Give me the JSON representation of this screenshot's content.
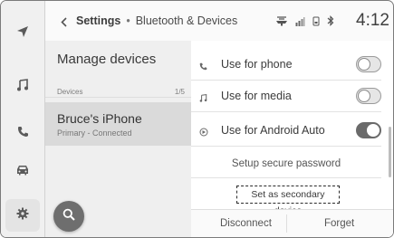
{
  "header": {
    "back_icon": "chevron-left-icon",
    "breadcrumb_primary": "Settings",
    "breadcrumb_separator": "•",
    "breadcrumb_secondary": "Bluetooth & Devices",
    "clock": "4:12",
    "status_icons": [
      "phone-link-icon",
      "signal-bars-icon",
      "phone-battery-icon",
      "bluetooth-icon"
    ]
  },
  "rail": {
    "items": [
      {
        "name": "navigation-icon"
      },
      {
        "name": "music-icon"
      },
      {
        "name": "phone-icon"
      },
      {
        "name": "car-icon"
      },
      {
        "name": "settings-gear-icon"
      }
    ]
  },
  "list": {
    "title": "Manage devices",
    "section_label": "Devices",
    "section_count": "1/5",
    "devices": [
      {
        "name": "Bruce's iPhone",
        "status": "Primary - Connected"
      }
    ]
  },
  "search_icon": "search-icon",
  "options": [
    {
      "icon": "phone-icon",
      "label": "Use for phone",
      "enabled": false
    },
    {
      "icon": "music-note-icon",
      "label": "Use for media",
      "enabled": false
    },
    {
      "icon": "android-auto-icon",
      "label_prefix": "Use for ",
      "label_emphasis": "Android Auto",
      "enabled": true
    }
  ],
  "actions": {
    "setup_password": "Setup secure password",
    "set_secondary": "Set as secondary device",
    "disconnect": "Disconnect",
    "forget": "Forget"
  },
  "colors": {
    "toggle_on": "#6a6a6a",
    "toggle_off": "#e6e6e6",
    "selected_item": "#dadada"
  }
}
